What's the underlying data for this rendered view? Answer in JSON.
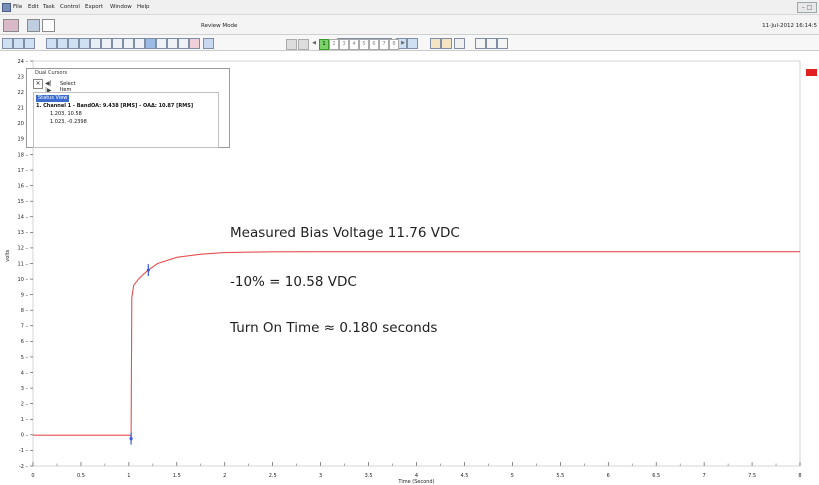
{
  "menubar": {
    "items": [
      "File",
      "Edit",
      "Task",
      "Control",
      "Export",
      "Window",
      "Help"
    ]
  },
  "toolbar": {
    "mode_label": "Review Mode",
    "date_label": "11-Jul-2012 16:14:5",
    "pager_pages": [
      "1",
      "2",
      "3",
      "4",
      "5",
      "6",
      "7",
      "8"
    ],
    "active_page": "1"
  },
  "cursor_panel": {
    "title": "Dual Cursors",
    "select_label": "Select Item Below:",
    "status_tab": "Status View",
    "channel_line": "1. Channel 1 - BandOA: 9.438 [RMS] - OAΔ: 10.87 [RMS]",
    "cursor1": "1.203, 10.58",
    "cursor2": "1.023, -0.2398"
  },
  "annotations": {
    "bias": "Measured Bias Voltage 11.76 VDC",
    "ten_percent": "-10% = 10.58 VDC",
    "turn_on": "Turn On Time ≈ 0.180 seconds"
  },
  "chart_data": {
    "type": "line",
    "ylabel": "volts",
    "xlabel": "Time (Second)",
    "xlim": [
      0,
      8
    ],
    "ylim": [
      -2,
      24
    ],
    "xticks": [
      "0",
      "0.5",
      "1",
      "1.5",
      "2",
      "2.5",
      "3",
      "3.5",
      "4",
      "4.5",
      "5",
      "5.5",
      "6",
      "6.5",
      "7",
      "7.5",
      "8"
    ],
    "yticks": [
      "-2",
      "-1",
      "0",
      "1",
      "2",
      "3",
      "4",
      "5",
      "6",
      "7",
      "8",
      "9",
      "10",
      "11",
      "12",
      "13",
      "14",
      "15",
      "16",
      "17",
      "18",
      "19",
      "20",
      "21",
      "22",
      "23",
      "24"
    ],
    "series": [
      {
        "color": "#e55050",
        "x": [
          0,
          0.5,
          1.0,
          1.02,
          1.023,
          1.03,
          1.05,
          1.1,
          1.15,
          1.203,
          1.3,
          1.5,
          1.75,
          2.0,
          2.5,
          3.0,
          4.0,
          5.0,
          6.0,
          7.0,
          8.0
        ],
        "y": [
          -0.02,
          -0.02,
          -0.02,
          -0.05,
          -0.24,
          8.8,
          9.6,
          10.0,
          10.3,
          10.58,
          11.0,
          11.4,
          11.6,
          11.7,
          11.75,
          11.76,
          11.76,
          11.76,
          11.76,
          11.76,
          11.76
        ]
      }
    ],
    "cursors": [
      {
        "x": 1.023,
        "y": -0.2398,
        "color": "#3a5ad8"
      },
      {
        "x": 1.203,
        "y": 10.58,
        "color": "#3a5ad8"
      }
    ]
  }
}
